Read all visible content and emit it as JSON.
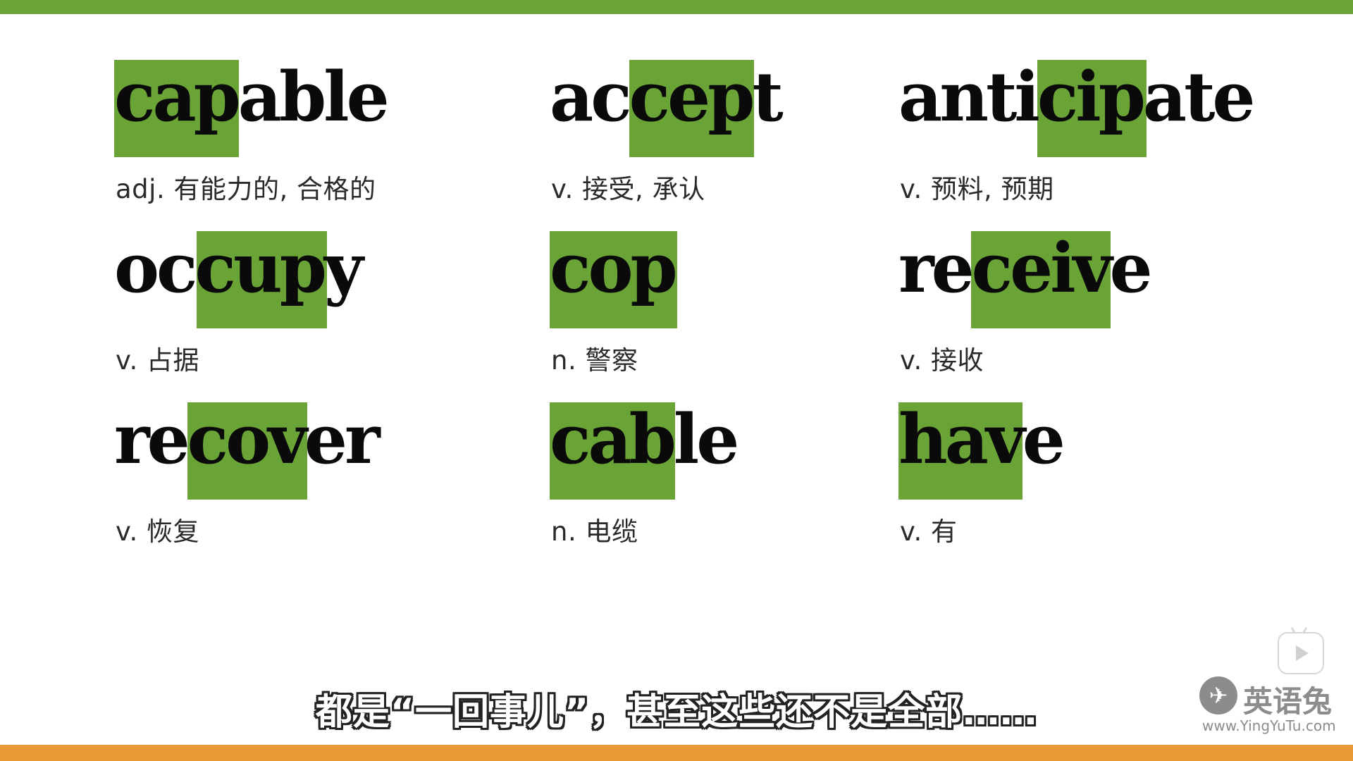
{
  "words": [
    {
      "word": "capable",
      "definition": "adj. 有能力的, 合格的"
    },
    {
      "word": "accept",
      "definition": "v. 接受, 承认"
    },
    {
      "word": "anticipate",
      "definition": "v. 预料, 预期"
    },
    {
      "word": "occupy",
      "definition": "v. 占据"
    },
    {
      "word": "cop",
      "definition": "n. 警察"
    },
    {
      "word": "receive",
      "definition": "v. 接收"
    },
    {
      "word": "recover",
      "definition": "v. 恢复"
    },
    {
      "word": "cable",
      "definition": "n. 电缆"
    },
    {
      "word": "have",
      "definition": "v. 有"
    }
  ],
  "subtitle": "都是“一回事儿”，甚至这些还不是全部……",
  "logo": {
    "name": "英语兔",
    "url": "www.YingYuTu.com",
    "icon": "rabbit-logo-icon"
  },
  "colors": {
    "highlight": "#6aa336",
    "top_bar": "#6aa336",
    "bottom_bar": "#e99a36"
  }
}
